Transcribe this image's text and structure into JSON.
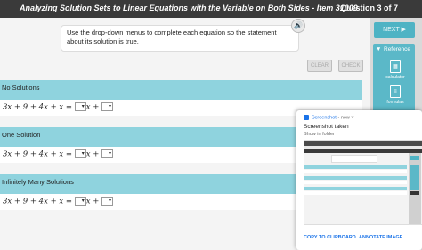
{
  "header": {
    "title": "Analyzing Solution Sets to Linear Equations with the Variable on Both Sides - Item 31009",
    "question_counter": "Question 3 of 7"
  },
  "instructions": {
    "text": "Use the drop-down menus to complete each equation so the statement about its solution is true.",
    "audio_icon": "speaker-icon"
  },
  "buttons": {
    "clear": "CLEAR",
    "check": "CHECK",
    "next": "NEXT ▶"
  },
  "sections": [
    {
      "heading": "No Solutions",
      "equation_left": "3x + 9 + 4x + x = ",
      "mid": "x + ",
      "dropdown1": "",
      "dropdown2": ""
    },
    {
      "heading": "One Solution",
      "equation_left": "3x + 9 + 4x + x = ",
      "mid": "x + ",
      "dropdown1": "",
      "dropdown2": ""
    },
    {
      "heading": "Infinitely Many Solutions",
      "equation_left": "3x + 9 + 4x + x = ",
      "mid": "x + ",
      "dropdown1": "",
      "dropdown2": ""
    }
  ],
  "reference": {
    "label": "Reference",
    "items": [
      {
        "label": "calculator",
        "icon": "calculator-icon"
      },
      {
        "label": "formulas",
        "icon": "formulas-icon"
      }
    ]
  },
  "notification": {
    "app_name": "Screenshot",
    "time": "now",
    "title": "Screenshot taken",
    "subtitle": "Show in folder",
    "action_copy": "COPY TO CLIPBOARD",
    "action_annotate": "ANNOTATE IMAGE"
  },
  "colors": {
    "section_head": "#8fd3de",
    "accent": "#4fb3c4",
    "topbar": "#3a3a3a",
    "link": "#1a73e8"
  }
}
